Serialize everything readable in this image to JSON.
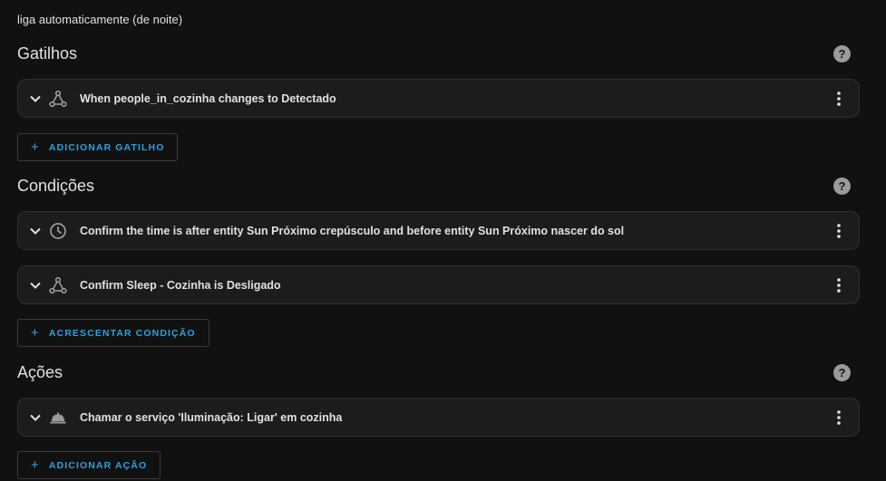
{
  "description": "liga automaticamente (de noite)",
  "sections": {
    "triggers": {
      "title": "Gatilhos",
      "help_icon": "question-circle-icon",
      "items": [
        {
          "label": "When people_in_cozinha changes to Detectado",
          "icon": "state-change-icon"
        }
      ],
      "add_label": "ADICIONAR GATILHO"
    },
    "conditions": {
      "title": "Condições",
      "help_icon": "question-circle-icon",
      "items": [
        {
          "label": "Confirm the time is after entity Sun Próximo crepúsculo and before entity Sun Próximo nascer do sol",
          "icon": "clock-icon"
        },
        {
          "label": "Confirm Sleep - Cozinha is Desligado",
          "icon": "state-change-icon"
        }
      ],
      "add_label": "ACRESCENTAR CONDIÇÃO"
    },
    "actions": {
      "title": "Ações",
      "help_icon": "question-circle-icon",
      "items": [
        {
          "label": "Chamar o serviço 'Iluminação: Ligar' em cozinha",
          "icon": "room-service-bell-icon"
        }
      ],
      "add_label": "ADICIONAR AÇÃO"
    }
  },
  "colors": {
    "background": "#111111",
    "card": "#1c1c1c",
    "accent": "#2aa2df",
    "text": "#e1e1e1",
    "icon": "#9b9b9b"
  }
}
